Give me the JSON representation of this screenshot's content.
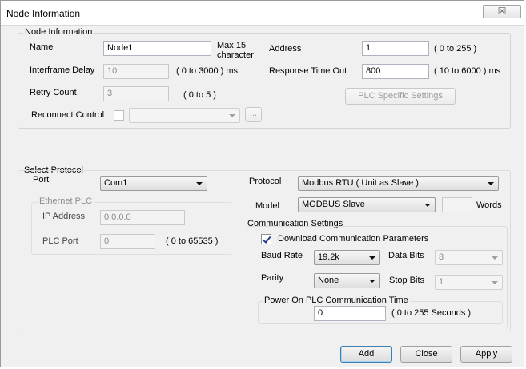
{
  "window": {
    "title": "Node Information",
    "close_glyph": "☒"
  },
  "node_group": {
    "legend": "Node Information",
    "name_label": "Name",
    "name_value": "Node1",
    "name_hint_line1": "Max 15",
    "name_hint_line2": "character",
    "address_label": "Address",
    "address_value": "1",
    "address_range": "( 0 to 255 )",
    "interframe_label": "Interframe Delay",
    "interframe_value": "10",
    "interframe_range": "( 0 to 3000 ) ms",
    "response_label": "Response Time Out",
    "response_value": "800",
    "response_range": "( 10 to 6000 ) ms",
    "retry_label": "Retry Count",
    "retry_value": "3",
    "retry_range": "( 0 to 5 )",
    "plc_specific_button": "PLC Specific Settings",
    "reconnect_label": "Reconnect Control",
    "reconnect_checked": false,
    "reconnect_select_value": "",
    "reconnect_browse": "..."
  },
  "protocol_group": {
    "legend": "Select Protocol",
    "port_label": "Port",
    "port_value": "Com1",
    "ethernet_legend": "Ethernet PLC",
    "ip_label": "IP Address",
    "ip_value": "0.0.0.0",
    "plc_port_label": "PLC Port",
    "plc_port_value": "0",
    "plc_port_range": "( 0 to 65535 )",
    "protocol_label": "Protocol",
    "protocol_value": "Modbus RTU ( Unit as Slave )",
    "model_label": "Model",
    "model_value": "MODBUS Slave",
    "words_value": "",
    "words_label": "Words"
  },
  "comm_settings": {
    "legend": "Communication Settings",
    "download_label": "Download Communication Parameters",
    "download_checked": true,
    "baud_label": "Baud Rate",
    "baud_value": "19.2k",
    "data_bits_label": "Data Bits",
    "data_bits_value": "8",
    "parity_label": "Parity",
    "parity_value": "None",
    "stop_bits_label": "Stop Bits",
    "stop_bits_value": "1",
    "power_on_legend": "Power On PLC Communication Time",
    "power_on_value": "0",
    "power_on_range": "( 0 to 255 Seconds )"
  },
  "footer": {
    "add": "Add",
    "close": "Close",
    "apply": "Apply"
  },
  "colors": {
    "window_bg": "#f0f0f0",
    "default_button_border": "#3c7fb1",
    "check_mark": "#1b3d8a"
  }
}
